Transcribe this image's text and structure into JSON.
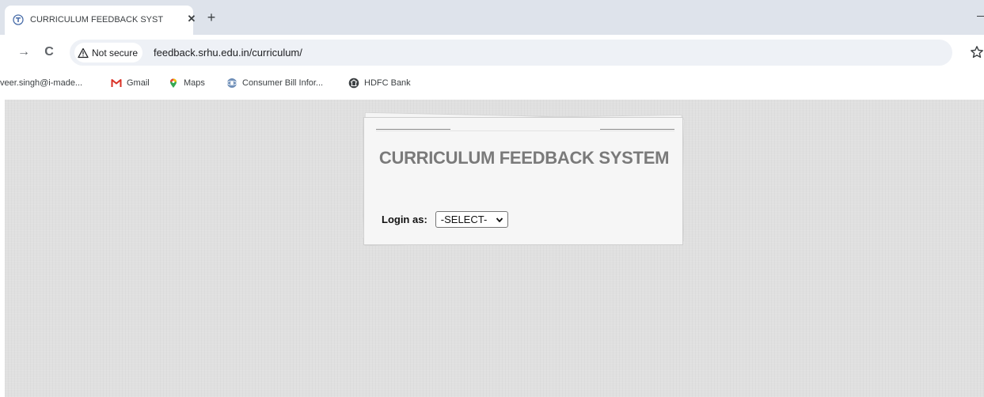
{
  "tab": {
    "title": "CURRICULUM FEEDBACK SYSTE",
    "close_glyph": "✕",
    "new_tab_glyph": "+"
  },
  "toolbar": {
    "forward_glyph": "→",
    "reload_glyph": "C",
    "security_text": "Not secure",
    "url": "feedback.srhu.edu.in/curriculum/"
  },
  "bookmarks": [
    {
      "label": "veer.singh@i-made...",
      "icon": "none"
    },
    {
      "label": "Gmail",
      "icon": "gmail-icon"
    },
    {
      "label": "Maps",
      "icon": "maps-icon"
    },
    {
      "label": "Consumer Bill Infor...",
      "icon": "globe-icon"
    },
    {
      "label": "HDFC Bank",
      "icon": "hdfc-icon"
    }
  ],
  "page": {
    "title": "CURRICULUM FEEDBACK SYSTEM",
    "login_label": "Login as:",
    "login_select_value": "-SELECT-"
  },
  "colors": {
    "tabstrip": "#dee3eb",
    "page_bg": "#e0e0e0",
    "title": "#7a7a7a",
    "gmail_red": "#d93025"
  }
}
